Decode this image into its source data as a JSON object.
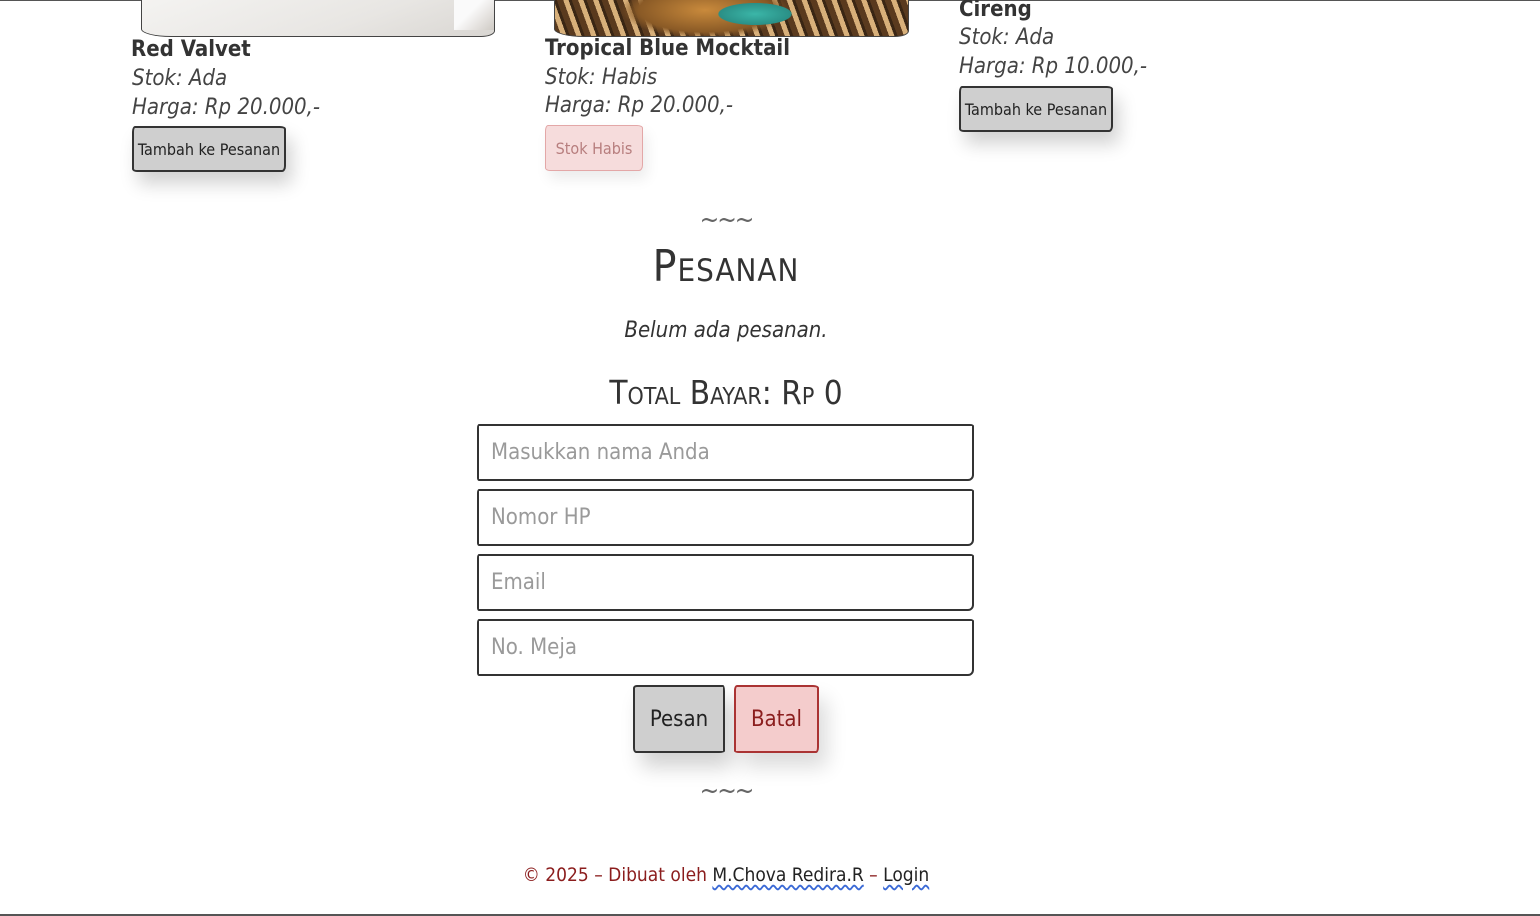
{
  "products": [
    {
      "name": "Red Valvet",
      "stock": "Stok: Ada",
      "price": "Harga: Rp 20.000,-",
      "button": "Tambah ke Pesanan",
      "image": "cake-photo"
    },
    {
      "name": "Tropical Blue Mocktail",
      "stock": "Stok: Habis",
      "price": "Harga: Rp 20.000,-",
      "button": "Stok Habis",
      "image": "mocktail-photo"
    },
    {
      "name": "Cireng",
      "stock": "Stok: Ada",
      "price": "Harga: Rp 10.000,-",
      "button": "Tambah ke Pesanan"
    }
  ],
  "order": {
    "divider": "~~~",
    "title": "Pesanan",
    "empty": "Belum ada pesanan.",
    "total": "Total Bayar: Rp 0",
    "fields": {
      "name_placeholder": "Masukkan nama Anda",
      "phone_placeholder": "Nomor HP",
      "email_placeholder": "Email",
      "table_placeholder": "No. Meja"
    },
    "submit_label": "Pesan",
    "cancel_label": "Batal"
  },
  "footer": {
    "prefix": "© 2025 – Dibuat oleh ",
    "author": "M.Chova Redira.R",
    "separator": " – ",
    "login": "Login"
  },
  "colors": {
    "button_gray": "#cfcfcf",
    "cancel_red": "#8b1d1d",
    "soldout_pink": "#f6dcdc"
  }
}
